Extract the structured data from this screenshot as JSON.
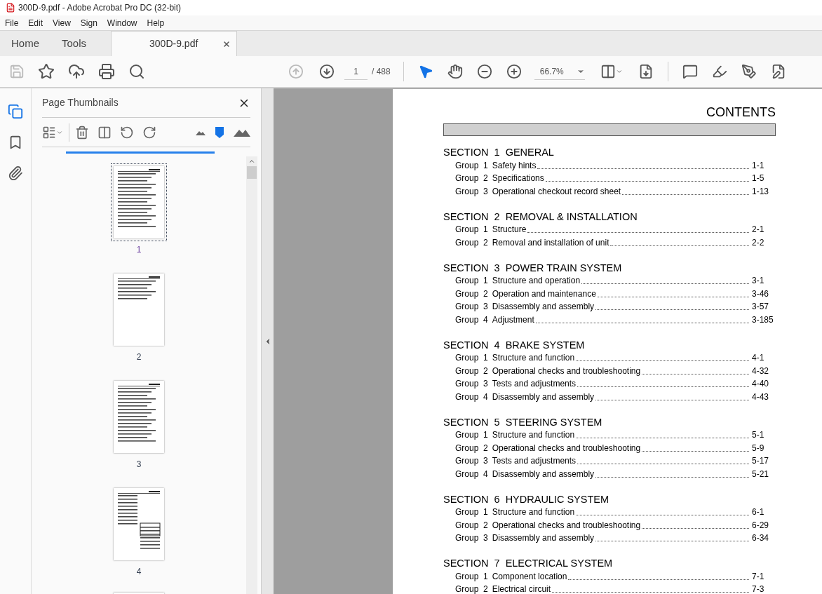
{
  "window": {
    "title": "300D-9.pdf - Adobe Acrobat Pro DC (32-bit)"
  },
  "menu": [
    "File",
    "Edit",
    "View",
    "Sign",
    "Window",
    "Help"
  ],
  "tabs": [
    {
      "label": "Home",
      "kind": "nav",
      "selected": false
    },
    {
      "label": "Tools",
      "kind": "nav",
      "selected": false
    },
    {
      "label": "300D-9.pdf",
      "kind": "document",
      "selected": true
    }
  ],
  "toolbar": {
    "page": "1",
    "total": "/ 488",
    "zoom": "66.7%"
  },
  "panel": {
    "title": "Page Thumbnails",
    "thumbnails": [
      {
        "label": "1",
        "selected": true
      },
      {
        "label": "2",
        "selected": false
      },
      {
        "label": "3",
        "selected": false
      },
      {
        "label": "4",
        "selected": false
      }
    ]
  },
  "document": {
    "heading": "CONTENTS",
    "sections": [
      {
        "title": "SECTION  1  GENERAL",
        "groups": [
          {
            "group": "Group  1",
            "title": "Safety hints",
            "page": "1-1"
          },
          {
            "group": "Group  2",
            "title": "Specifications",
            "page": "1-5"
          },
          {
            "group": "Group  3",
            "title": "Operational checkout record sheet",
            "page": "1-13"
          }
        ]
      },
      {
        "title": "SECTION  2  REMOVAL & INSTALLATION",
        "groups": [
          {
            "group": "Group  1",
            "title": "Structure",
            "page": "2-1"
          },
          {
            "group": "Group  2",
            "title": "Removal and installation of unit",
            "page": "2-2"
          }
        ]
      },
      {
        "title": "SECTION  3  POWER TRAIN SYSTEM",
        "groups": [
          {
            "group": "Group  1",
            "title": "Structure and operation",
            "page": "3-1"
          },
          {
            "group": "Group  2",
            "title": "Operation and maintenance",
            "page": "3-46"
          },
          {
            "group": "Group  3",
            "title": "Disassembly and assembly",
            "page": "3-57"
          },
          {
            "group": "Group  4",
            "title": "Adjustment",
            "page": "3-185"
          }
        ]
      },
      {
        "title": "SECTION  4  BRAKE SYSTEM",
        "groups": [
          {
            "group": "Group  1",
            "title": "Structure and function",
            "page": "4-1"
          },
          {
            "group": "Group  2",
            "title": "Operational checks and troubleshooting",
            "page": "4-32"
          },
          {
            "group": "Group  3",
            "title": "Tests and adjustments",
            "page": "4-40"
          },
          {
            "group": "Group  4",
            "title": "Disassembly and assembly",
            "page": "4-43"
          }
        ]
      },
      {
        "title": "SECTION  5  STEERING SYSTEM",
        "groups": [
          {
            "group": "Group  1",
            "title": "Structure and function",
            "page": "5-1"
          },
          {
            "group": "Group  2",
            "title": "Operational checks and troubleshooting",
            "page": "5-9"
          },
          {
            "group": "Group  3",
            "title": "Tests and adjustments",
            "page": "5-17"
          },
          {
            "group": "Group  4",
            "title": "Disassembly and assembly",
            "page": "5-21"
          }
        ]
      },
      {
        "title": "SECTION  6  HYDRAULIC SYSTEM",
        "groups": [
          {
            "group": "Group  1",
            "title": "Structure and function",
            "page": "6-1"
          },
          {
            "group": "Group  2",
            "title": "Operational checks and troubleshooting",
            "page": "6-29"
          },
          {
            "group": "Group  3",
            "title": "Disassembly and assembly",
            "page": "6-34"
          }
        ]
      },
      {
        "title": "SECTION  7  ELECTRICAL SYSTEM",
        "groups": [
          {
            "group": "Group  1",
            "title": "Component location",
            "page": "7-1"
          },
          {
            "group": "Group  2",
            "title": "Electrical circuit",
            "page": "7-3"
          }
        ]
      }
    ]
  }
}
